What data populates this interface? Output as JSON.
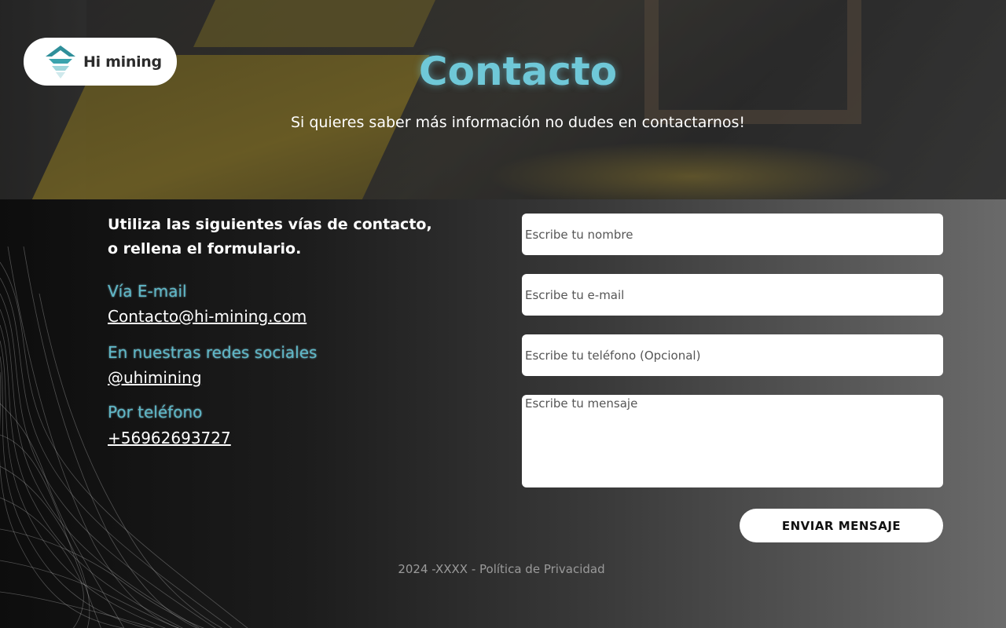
{
  "brand": {
    "name": "Hi mining",
    "icon": "mountain-logo-icon"
  },
  "hero": {
    "title": "Contacto",
    "subtitle": "Si quieres saber más información no dudes en contactarnos!"
  },
  "contact": {
    "intro_line1": "Utiliza las siguientes vías de contacto,",
    "intro_line2": "o rellena el formulario.",
    "email_label": "Vía E-mail",
    "email_value": "Contacto@hi-mining.com",
    "social_label": "En nuestras redes sociales",
    "social_value": "@uhimining",
    "phone_label": "Por teléfono",
    "phone_value": "+56962693727"
  },
  "form": {
    "name_placeholder": "Escribe tu nombre",
    "email_placeholder": "Escribe tu e-mail",
    "phone_placeholder": "Escribe tu teléfono (Opcional)",
    "message_placeholder": "Escribe tu mensaje",
    "submit_label": "ENVIAR MENSAJE"
  },
  "footer": {
    "year": "2024 -XXXX",
    "separator": " - ",
    "privacy_label": "Política de Privacidad"
  },
  "colors": {
    "accent": "#6fc8d8",
    "label": "#5fb8c8",
    "logo_teal": "#2f8f9a"
  }
}
